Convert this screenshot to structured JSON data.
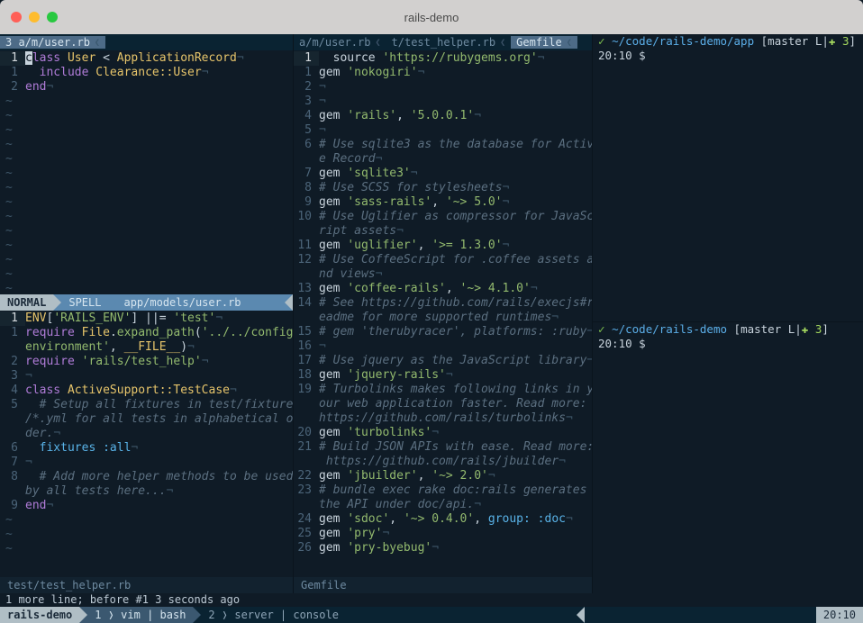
{
  "titlebar": {
    "title": "rails-demo"
  },
  "pane1": {
    "tabs": [
      {
        "label": "3 a/m/user.rb",
        "active": true
      }
    ],
    "top_lines": [
      {
        "n": "1",
        "active": true,
        "html": "<span class='cursor'>c</span><span class='kw'>lass</span> <span class='cls'>User</span> &lt; <span class='cls'>ApplicationRecord</span><span class='nl'>¬</span>"
      },
      {
        "n": "1",
        "html": "  <span class='kw'>include</span> <span class='cls'>Clearance::User</span><span class='nl'>¬</span>"
      },
      {
        "n": "2",
        "html": "<span class='kw'>end</span><span class='nl'>¬</span>"
      }
    ],
    "top_tildes": 14,
    "status_active": {
      "mode": "NORMAL",
      "spell": "SPELL",
      "path": "app/models/user.rb"
    },
    "bot_lines": [
      {
        "n": "1",
        "active": true,
        "html": "<span class='const'>ENV</span>[<span class='str'>'RAILS_ENV'</span>] ||= <span class='str'>'test'</span><span class='nl'>¬</span>"
      },
      {
        "n": "1",
        "html": "<span class='kw'>require</span> <span class='cls'>File</span>.<span class='fn'>expand_path</span>(<span class='str'>'../../config/</span>"
      },
      {
        "n": "",
        "html": "<span class='str'>environment'</span>, <span class='const'>__FILE__</span>)<span class='nl'>¬</span>"
      },
      {
        "n": "2",
        "html": "<span class='kw'>require</span> <span class='str'>'rails/test_help'</span><span class='nl'>¬</span>"
      },
      {
        "n": "3",
        "html": "<span class='nl'>¬</span>"
      },
      {
        "n": "4",
        "html": "<span class='kw'>class</span> <span class='cls'>ActiveSupport::TestCase</span><span class='nl'>¬</span>"
      },
      {
        "n": "5",
        "html": "  <span class='com'># Setup all fixtures in test/fixtures</span>"
      },
      {
        "n": "",
        "html": "<span class='com'>/*.yml for all tests in alphabetical or</span>"
      },
      {
        "n": "",
        "html": "<span class='com'>der.</span><span class='nl'>¬</span>"
      },
      {
        "n": "6",
        "html": "  <span class='sym'>fixtures</span> <span class='sym'>:all</span><span class='nl'>¬</span>"
      },
      {
        "n": "7",
        "html": "<span class='nl'>¬</span>"
      },
      {
        "n": "8",
        "html": "  <span class='com'># Add more helper methods to be used</span>"
      },
      {
        "n": "",
        "html": "<span class='com'>by all tests here...</span><span class='nl'>¬</span>"
      },
      {
        "n": "9",
        "html": "<span class='kw'>end</span><span class='nl'>¬</span>"
      }
    ],
    "bot_tildes": 3,
    "status_bot": "test/test_helper.rb"
  },
  "pane2": {
    "tabs": [
      {
        "label": "a/m/user.rb"
      },
      {
        "label": "t/test_helper.rb"
      },
      {
        "label": "Gemfile",
        "active": true
      }
    ],
    "lines": [
      {
        "n": "1",
        "active": true,
        "html": "  source <span class='str'>'https://rubygems.org'</span><span class='nl'>¬</span>"
      },
      {
        "n": "1",
        "html": "gem <span class='str'>'nokogiri'</span><span class='nl'>¬</span>"
      },
      {
        "n": "2",
        "html": "<span class='nl'>¬</span>"
      },
      {
        "n": "3",
        "html": "<span class='nl'>¬</span>"
      },
      {
        "n": "4",
        "html": "gem <span class='str'>'rails'</span>, <span class='str'>'5.0.0.1'</span><span class='nl'>¬</span>"
      },
      {
        "n": "5",
        "html": "<span class='nl'>¬</span>"
      },
      {
        "n": "6",
        "html": "<span class='com'># Use sqlite3 as the database for Activ</span>"
      },
      {
        "n": "",
        "html": "<span class='com'>e Record</span><span class='nl'>¬</span>"
      },
      {
        "n": "7",
        "html": "gem <span class='str'>'sqlite3'</span><span class='nl'>¬</span>"
      },
      {
        "n": "8",
        "html": "<span class='com'># Use SCSS for stylesheets</span><span class='nl'>¬</span>"
      },
      {
        "n": "9",
        "html": "gem <span class='str'>'sass-rails'</span>, <span class='str'>'~> 5.0'</span><span class='nl'>¬</span>"
      },
      {
        "n": "10",
        "html": "<span class='com'># Use Uglifier as compressor for JavaSc</span>"
      },
      {
        "n": "",
        "html": "<span class='com'>ript assets</span><span class='nl'>¬</span>"
      },
      {
        "n": "11",
        "html": "gem <span class='str'>'uglifier'</span>, <span class='str'>'>= 1.3.0'</span><span class='nl'>¬</span>"
      },
      {
        "n": "12",
        "html": "<span class='com'># Use CoffeeScript for .coffee assets a</span>"
      },
      {
        "n": "",
        "html": "<span class='com'>nd views</span><span class='nl'>¬</span>"
      },
      {
        "n": "13",
        "html": "gem <span class='str'>'coffee-rails'</span>, <span class='str'>'~> 4.1.0'</span><span class='nl'>¬</span>"
      },
      {
        "n": "14",
        "html": "<span class='com'># See https://github.com/rails/execjs#r</span>"
      },
      {
        "n": "",
        "html": "<span class='com'>eadme for more supported runtimes</span><span class='nl'>¬</span>"
      },
      {
        "n": "15",
        "html": "<span class='com'># gem 'therubyracer', platforms: :ruby</span><span class='nl'>¬</span>"
      },
      {
        "n": "16",
        "html": "<span class='nl'>¬</span>"
      },
      {
        "n": "17",
        "html": "<span class='com'># Use jquery as the JavaScript library</span><span class='nl'>¬</span>"
      },
      {
        "n": "18",
        "html": "gem <span class='str'>'jquery-rails'</span><span class='nl'>¬</span>"
      },
      {
        "n": "19",
        "html": "<span class='com'># Turbolinks makes following links in y</span>"
      },
      {
        "n": "",
        "html": "<span class='com'>our web application faster. Read more:</span>"
      },
      {
        "n": "",
        "html": "<span class='com'>https://github.com/rails/turbolinks</span><span class='nl'>¬</span>"
      },
      {
        "n": "20",
        "html": "gem <span class='str'>'turbolinks'</span><span class='nl'>¬</span>"
      },
      {
        "n": "21",
        "html": "<span class='com'># Build JSON APIs with ease. Read more:</span>"
      },
      {
        "n": "",
        "html": "<span class='com'> https://github.com/rails/jbuilder</span><span class='nl'>¬</span>"
      },
      {
        "n": "22",
        "html": "gem <span class='str'>'jbuilder'</span>, <span class='str'>'~> 2.0'</span><span class='nl'>¬</span>"
      },
      {
        "n": "23",
        "html": "<span class='com'># bundle exec rake doc:rails generates </span>"
      },
      {
        "n": "",
        "html": "<span class='com'>the API under doc/api.</span><span class='nl'>¬</span>"
      },
      {
        "n": "24",
        "html": "gem <span class='str'>'sdoc'</span>, <span class='str'>'~> 0.4.0'</span>, <span class='sym'>group:</span> <span class='sym'>:doc</span><span class='nl'>¬</span>"
      },
      {
        "n": "25",
        "html": "gem <span class='str'>'pry'</span><span class='nl'>¬</span>"
      },
      {
        "n": "26",
        "html": "gem <span class='str'>'pry-byebug'</span><span class='nl'>¬</span>"
      }
    ],
    "status": "Gemfile"
  },
  "pane3": {
    "top": {
      "prompt_status": "✓",
      "path": "~/code/rails-demo/app",
      "branch": "master L|",
      "dirty": "✚ 3",
      "time_prompt": "20:10 $"
    },
    "bot": {
      "prompt_status": "✓",
      "path": "~/code/rails-demo",
      "branch": "master L|",
      "dirty": "✚ 3",
      "time_prompt": "20:10 $"
    }
  },
  "message": "1 more line; before #1  3 seconds ago",
  "tmux": {
    "session": "rails-demo",
    "windows": [
      {
        "idx": "1",
        "label": "vim | bash",
        "active": true
      },
      {
        "idx": "2",
        "label": "server | console",
        "active": false
      }
    ],
    "time": "20:10"
  }
}
